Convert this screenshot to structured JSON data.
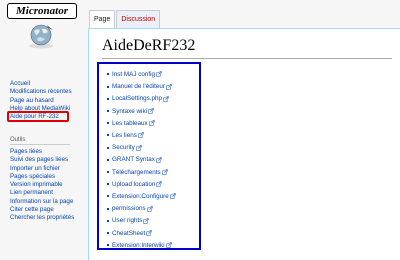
{
  "logo": {
    "text": "Micronator"
  },
  "nav": {
    "items": [
      "Accueil",
      "Modifications récentes",
      "Page au hasard",
      "Help about MediaWiki",
      "Aide pour RF-232"
    ]
  },
  "tools": {
    "heading": "Outils",
    "items": [
      "Pages liées",
      "Suivi des pages liées",
      "Importer un fichier",
      "Pages spéciales",
      "Version imprimable",
      "Lien permanent",
      "Information sur la page",
      "Citer cette page",
      "Chercher les propriétés"
    ]
  },
  "tabs": {
    "page": "Page",
    "discussion": "Discussion"
  },
  "page": {
    "title": "AideDeRF232",
    "links": [
      "Inst MAJ config",
      "Manuel de l'éditeur",
      "LocalSettings.php",
      "Syntaxe wiki",
      "Les tableaux",
      "Les liens",
      "Security",
      "GRANT Syntax",
      "Téléchargements",
      "Upload location",
      "Extension:Configure",
      "permissions",
      "User rights",
      "CheatSheet",
      "Extension:Interwiki"
    ]
  },
  "colors": {
    "highlight_red": "#e00000",
    "highlight_blue": "#0000cc",
    "link": "#0645ad",
    "redlink": "#ba0000"
  }
}
